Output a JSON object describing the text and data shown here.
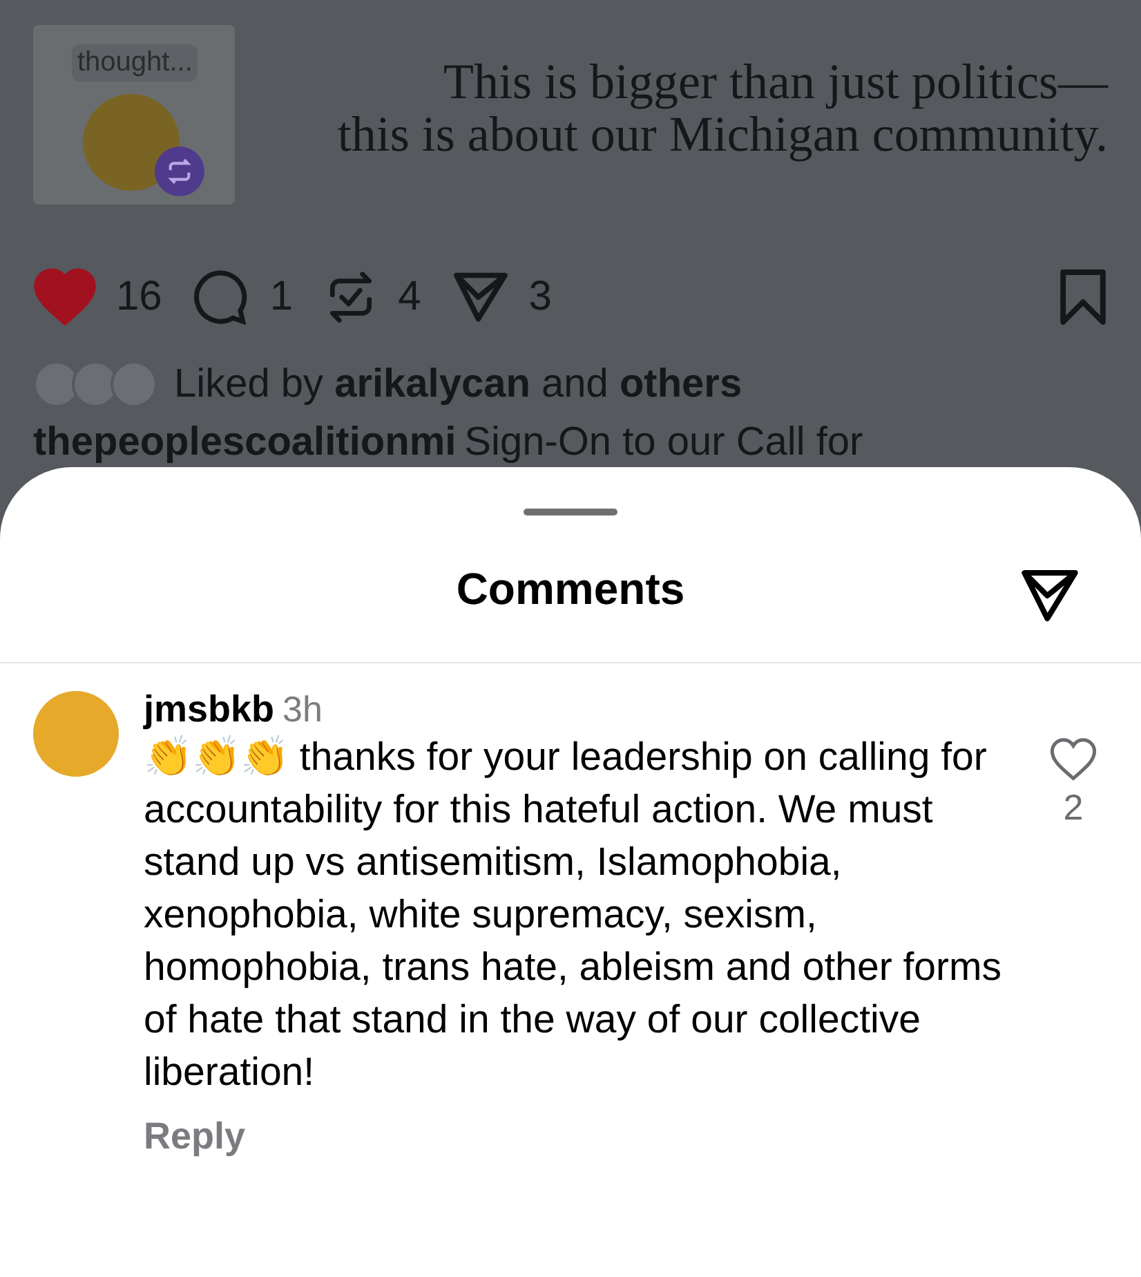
{
  "post": {
    "thought_hint": "thought...",
    "quote": "This is bigger than just politics—\nthis is about our Michigan community.",
    "actions": {
      "likes": "16",
      "liked": true,
      "comments": "1",
      "reposts": "4",
      "shares": "3"
    },
    "liked_by": "Liked by **arikalycan** and **others**",
    "caption_user": "thepeoplescoalitionmi",
    "caption_text": "Sign-On to our Call for"
  },
  "sheet": {
    "title": "Comments"
  },
  "comments": [
    {
      "user": "jmsbkb",
      "time": "3h",
      "text": "👏👏👏 thanks for your leadership on calling for accountability for this hateful action. We must stand up vs antisemitism, Islamophobia, xenophobia, white supremacy, sexism, homophobia, trans hate, ableism and other forms of hate that stand in the way of our collective liberation!",
      "likes": "2",
      "liked": false,
      "reply": "Reply"
    }
  ]
}
